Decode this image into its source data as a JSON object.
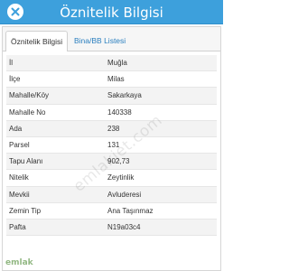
{
  "window": {
    "title": "Öznitelik Bilgisi",
    "accent_color": "#3da0dc"
  },
  "tabs": [
    {
      "label": "Öznitelik Bilgisi",
      "active": true
    },
    {
      "label": "Bina/BB Listesi",
      "active": false
    }
  ],
  "attributes": [
    {
      "key": "İl",
      "value": "Muğla"
    },
    {
      "key": "İlçe",
      "value": "Milas"
    },
    {
      "key": "Mahalle/Köy",
      "value": "Sakarkaya"
    },
    {
      "key": "Mahalle No",
      "value": "140338"
    },
    {
      "key": "Ada",
      "value": "238"
    },
    {
      "key": "Parsel",
      "value": "131"
    },
    {
      "key": "Tapu Alanı",
      "value": "902,73"
    },
    {
      "key": "Nitelik",
      "value": "Zeytinlik"
    },
    {
      "key": "Mevkii",
      "value": "Avluderesi"
    },
    {
      "key": "Zemin Tip",
      "value": "Ana Taşınmaz"
    },
    {
      "key": "Pafta",
      "value": "N19a03c4"
    }
  ],
  "watermark": "emlakjet.com",
  "logo_text": "emlak"
}
